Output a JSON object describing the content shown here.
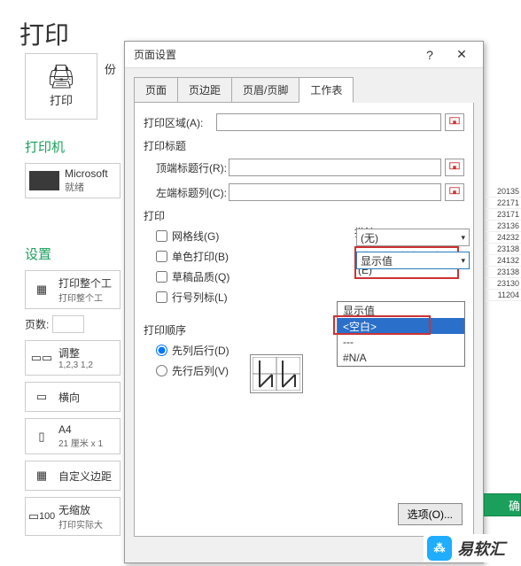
{
  "header": {
    "title": "打印"
  },
  "printButton": {
    "label": "打印"
  },
  "copies": {
    "label": "份"
  },
  "printer": {
    "section": "打印机",
    "name": "Microsoft",
    "status": "就绪"
  },
  "settings": {
    "section": "设置",
    "items": [
      {
        "label": "打印整个工",
        "sub": "打印整个工"
      },
      {
        "label": "调整",
        "sub": "1,2,3   1,2"
      },
      {
        "label": "横向",
        "sub": ""
      },
      {
        "label": "A4",
        "sub": "21 厘米 x 1"
      },
      {
        "label": "自定义边距",
        "sub": ""
      },
      {
        "label": "无缩放",
        "sub": "打印实际大"
      }
    ],
    "pagesLabel": "页数:"
  },
  "dialog": {
    "title": "页面设置",
    "help": "?",
    "tabs": [
      "页面",
      "页边距",
      "页眉/页脚",
      "工作表"
    ],
    "activeTab": 3,
    "printArea": {
      "label": "打印区域(A):"
    },
    "printTitles": {
      "group": "打印标题",
      "topRow": "顶端标题行(R):",
      "leftCol": "左端标题列(C):"
    },
    "printGroup": {
      "group": "打印",
      "gridlines": "网格线(G)",
      "bw": "单色打印(B)",
      "draft": "草稿品质(Q)",
      "rowcol": "行号列标(L)"
    },
    "comments": {
      "label": "批注(M):",
      "value": "(无)"
    },
    "errors": {
      "label": "错误单元格打印为(E)",
      "value": "显示值",
      "options": [
        "显示值",
        "<空白>",
        "---",
        "#N/A"
      ],
      "selectedIndex": 1
    },
    "order": {
      "group": "打印顺序",
      "downThenOver": "先列后行(D)",
      "overThenDown": "先行后列(V)"
    },
    "optionsBtn": "选项(O)..."
  },
  "confirm": "确",
  "logoText": "易软汇",
  "peekValues": [
    "20135",
    "22171",
    "23171",
    "23136",
    "24232",
    "23138",
    "24132",
    "23138",
    "23130",
    "11204"
  ]
}
